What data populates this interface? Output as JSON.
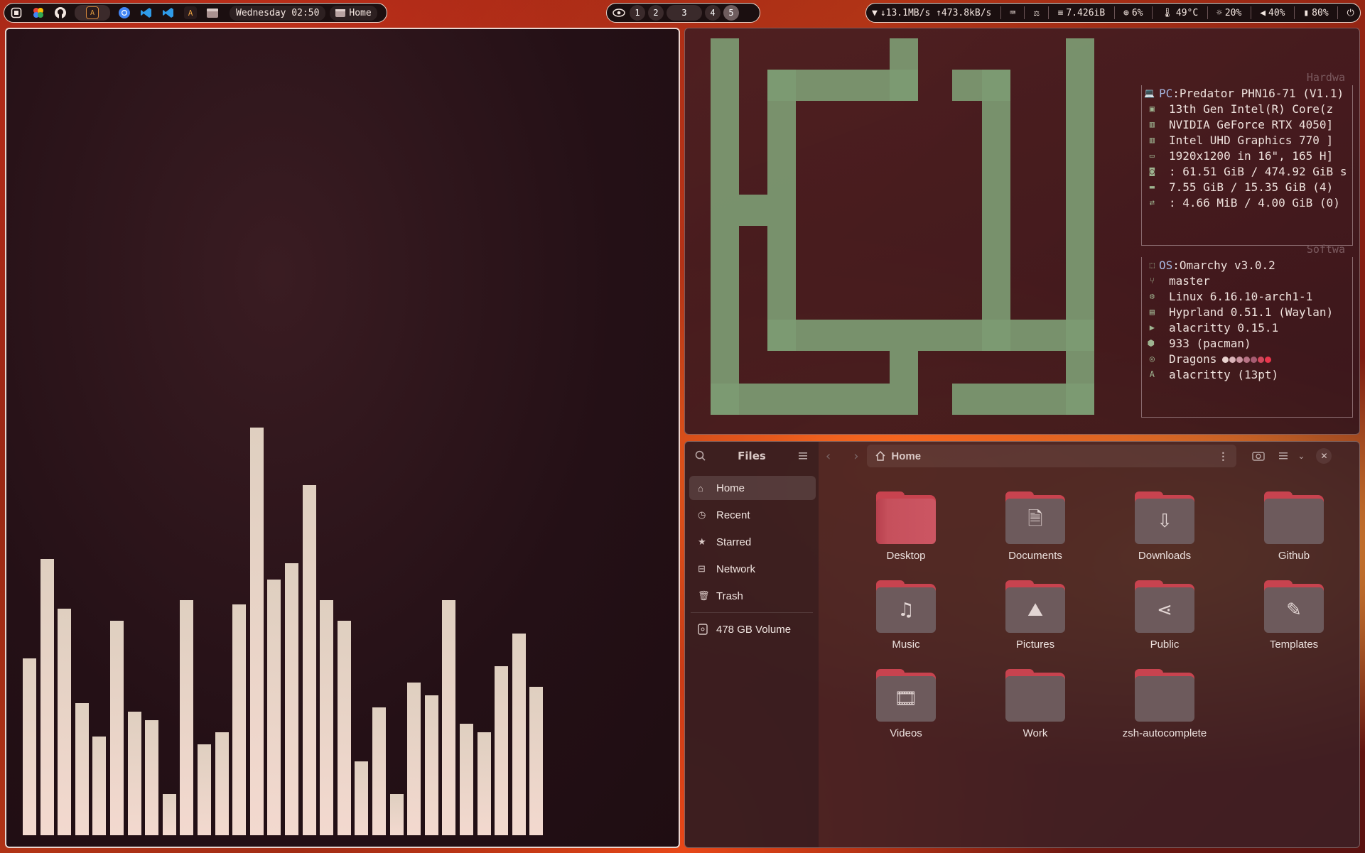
{
  "topbar": {
    "clock": "Wednesday 02:50",
    "active_window": "Home",
    "workspaces": [
      "1",
      "2",
      "3",
      "4",
      "5"
    ],
    "active_workspace": "5",
    "network": "↓13.1MB/s ↑473.8kB/s",
    "memory": "7.426iB",
    "cpu": "6%",
    "temperature": "49°C",
    "brightness": "20%",
    "volume": "40%",
    "battery": "80%"
  },
  "cava": {
    "levels": [
      0.43,
      0.67,
      0.55,
      0.32,
      0.24,
      0.52,
      0.3,
      0.28,
      0.1,
      0.57,
      0.22,
      0.25,
      0.56,
      0.99,
      0.62,
      0.66,
      0.85,
      0.57,
      0.52,
      0.18,
      0.31,
      0.1,
      0.37,
      0.34,
      0.57,
      0.27,
      0.25,
      0.41,
      0.49,
      0.36
    ]
  },
  "fastfetch": {
    "hardware_label": "Hardwa",
    "software_label": "Softwa",
    "hardware": [
      {
        "icon": "laptop-icon",
        "key": "PC",
        "value": "Predator PHN16-71 (V1.1)"
      },
      {
        "icon": "cpu-icon",
        "key": "",
        "value": "13th Gen Intel(R) Core(z"
      },
      {
        "icon": "gpu-icon",
        "key": "",
        "value": "NVIDIA GeForce RTX 4050]"
      },
      {
        "icon": "gpu-icon",
        "key": "",
        "value": "Intel UHD Graphics 770 ]"
      },
      {
        "icon": "display-icon",
        "key": "",
        "value": "1920x1200 in 16\", 165 H]"
      },
      {
        "icon": "disk-icon",
        "key": "",
        "value": ": 61.51 GiB / 474.92 GiB s"
      },
      {
        "icon": "memory-icon",
        "key": "",
        "value": "7.55 GiB / 15.35 GiB (4)"
      },
      {
        "icon": "swap-icon",
        "key": "",
        "value": ": 4.66 MiB / 4.00 GiB (0)"
      }
    ],
    "software": [
      {
        "icon": "os-icon",
        "key": "OS",
        "value": "Omarchy v3.0.2"
      },
      {
        "icon": "branch-icon",
        "key": "",
        "value": "master"
      },
      {
        "icon": "gear-icon",
        "key": "",
        "value": "Linux 6.16.10-arch1-1"
      },
      {
        "icon": "window-icon",
        "key": "",
        "value": "Hyprland 0.51.1 (Waylan)"
      },
      {
        "icon": "terminal-icon",
        "key": "",
        "value": "alacritty 0.15.1"
      },
      {
        "icon": "package-icon",
        "key": "",
        "value": "933 (pacman)"
      },
      {
        "icon": "palette-icon",
        "key": "",
        "value": "Dragons"
      },
      {
        "icon": "font-icon",
        "key": "",
        "value": "alacritty (13pt)"
      }
    ],
    "theme_dots": [
      "#e9d3cf",
      "#d9b3b8",
      "#c9939f",
      "#b77385",
      "#a65c72",
      "#d0485c",
      "#e8354c"
    ]
  },
  "files": {
    "title": "Files",
    "path": "Home",
    "sidebar": [
      {
        "icon": "home-icon",
        "label": "Home"
      },
      {
        "icon": "clock-icon",
        "label": "Recent"
      },
      {
        "icon": "star-icon",
        "label": "Starred"
      },
      {
        "icon": "network-icon",
        "label": "Network"
      },
      {
        "icon": "trash-icon",
        "label": "Trash"
      }
    ],
    "volume": "478 GB Volume",
    "folders": [
      {
        "label": "Desktop",
        "icon": "desktop-icon"
      },
      {
        "label": "Documents",
        "icon": "document-icon"
      },
      {
        "label": "Downloads",
        "icon": "download-icon"
      },
      {
        "label": "Github",
        "icon": "folder-icon"
      },
      {
        "label": "Music",
        "icon": "music-icon"
      },
      {
        "label": "Pictures",
        "icon": "picture-icon"
      },
      {
        "label": "Public",
        "icon": "share-icon"
      },
      {
        "label": "Templates",
        "icon": "template-icon"
      },
      {
        "label": "Videos",
        "icon": "video-icon"
      },
      {
        "label": "Work",
        "icon": "folder-icon"
      },
      {
        "label": "zsh-autocomplete",
        "icon": "folder-icon"
      }
    ]
  }
}
